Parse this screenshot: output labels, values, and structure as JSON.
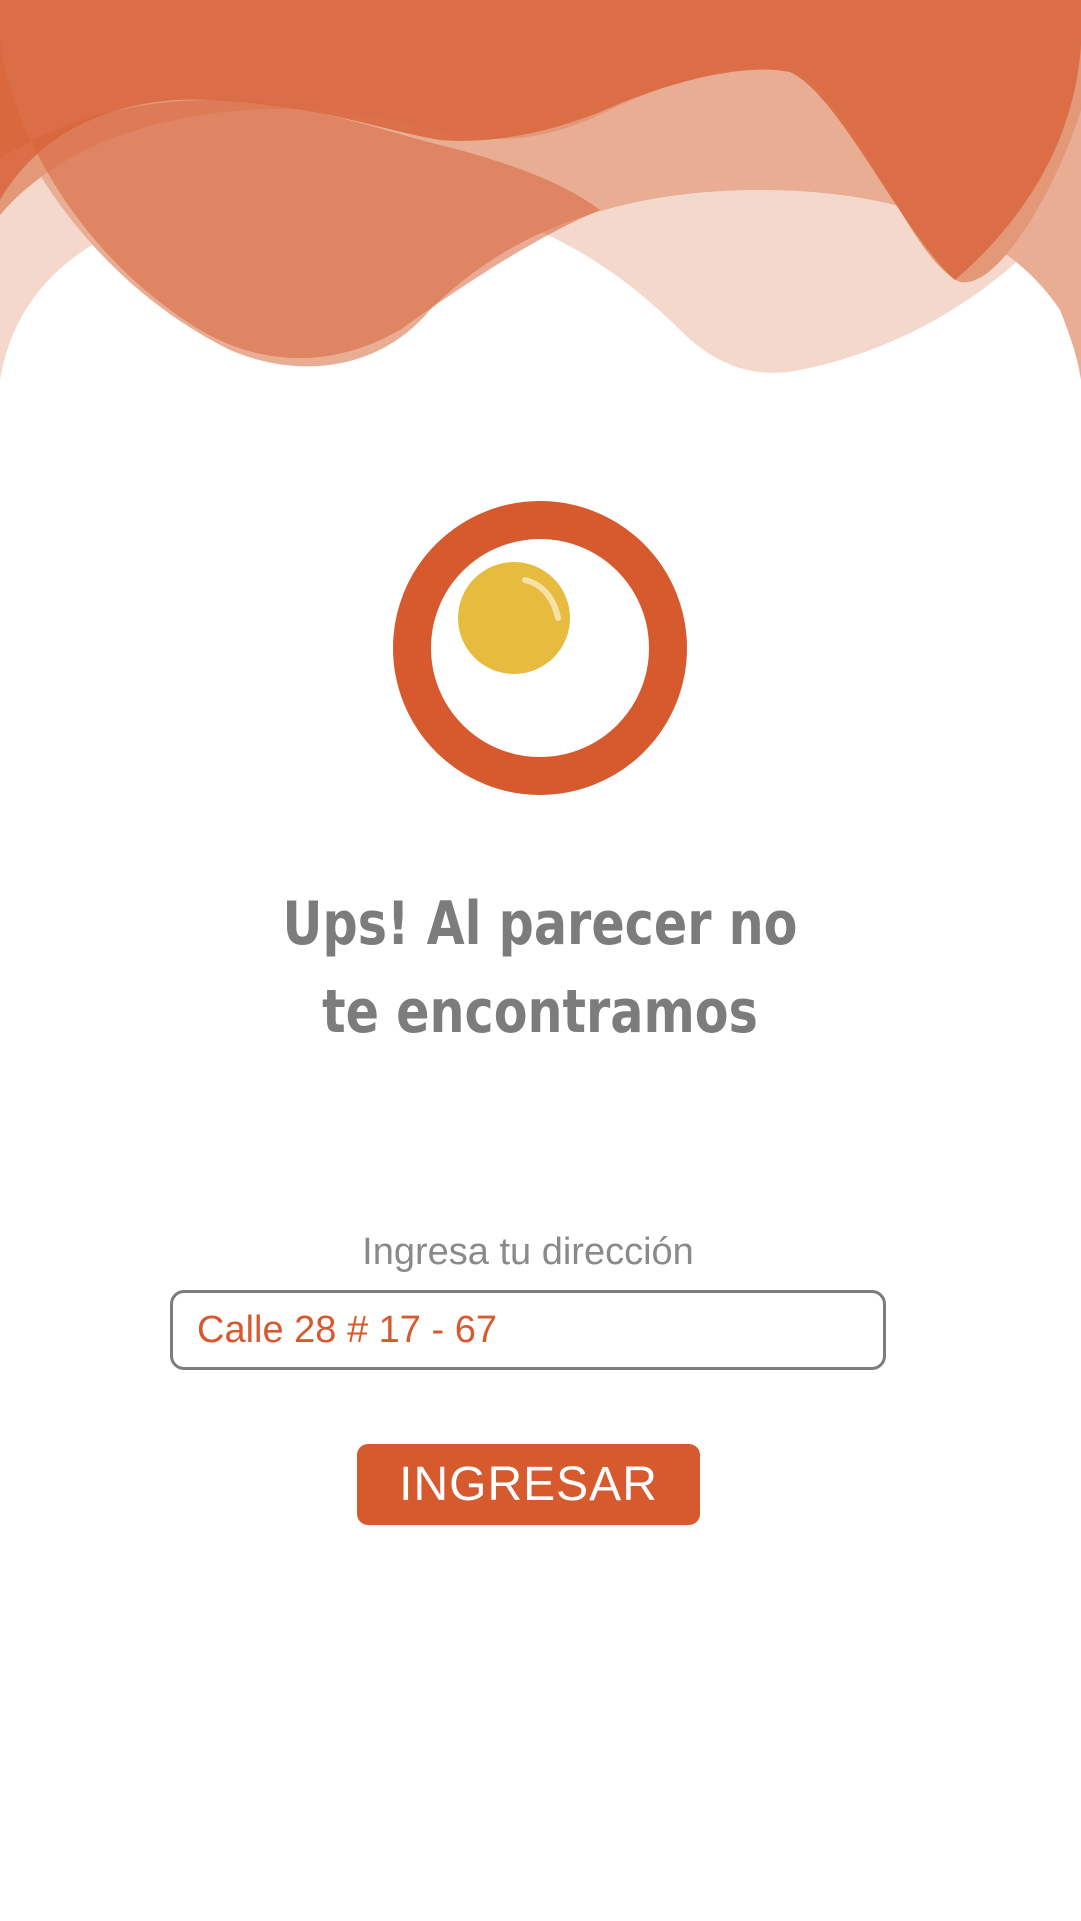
{
  "colors": {
    "accent": "#d65a2e",
    "yolk": "#e7bb3d",
    "text_gray": "#7c7c7c"
  },
  "header": {
    "decoration": "orange-waves"
  },
  "logo": {
    "icon": "fried-egg-icon"
  },
  "message": {
    "line1": "Ups! Al parecer no",
    "line2": "te encontramos"
  },
  "address": {
    "label": "Ingresa tu dirección",
    "value": "Calle 28 # 17 - 67"
  },
  "submit": {
    "label": "INGRESAR"
  }
}
